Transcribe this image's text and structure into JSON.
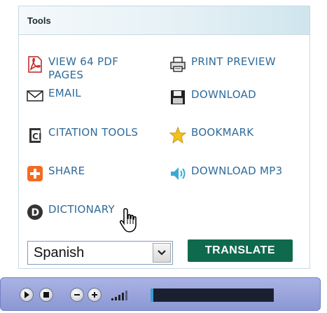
{
  "panel": {
    "title": "Tools"
  },
  "tools": {
    "view_pdf": "VIEW 64 PDF\nPAGES",
    "print_preview": "PRINT PREVIEW",
    "email": "EMAIL",
    "download": "DOWNLOAD",
    "citation": "CITATION TOOLS",
    "bookmark": "BOOKMARK",
    "share": "SHARE",
    "download_mp3": "DOWNLOAD MP3",
    "dictionary": "DICTIONARY"
  },
  "translate": {
    "language": "Spanish",
    "button": "TRANSLATE"
  },
  "player": {
    "progress_fraction": 0.02
  },
  "colors": {
    "link": "#2f6b9a",
    "translate_button": "#0f6a4d",
    "player_bg": "#98a2dc"
  }
}
